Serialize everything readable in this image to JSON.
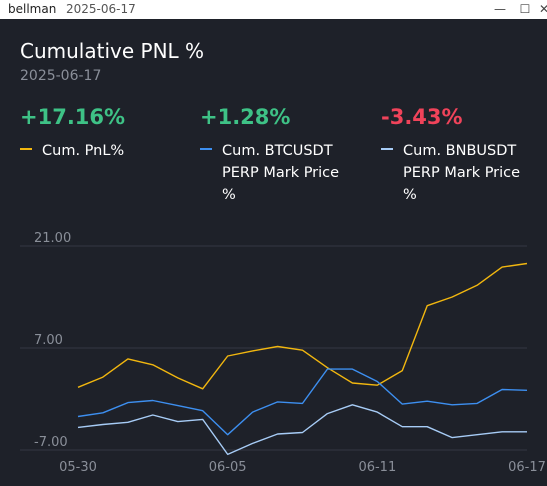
{
  "window": {
    "app_name": "bellman",
    "title_date": "2025-06-17",
    "min_glyph": "—",
    "max_glyph": "☐",
    "close_glyph": "✕"
  },
  "panel": {
    "title": "Cumulative PNL %",
    "subtitle": "2025-06-17"
  },
  "stats": [
    {
      "value": "+17.16%",
      "color": "#3ec286",
      "legend_lines": [
        "Cum. PnL%"
      ],
      "legend_color": "#f2b70f"
    },
    {
      "value": "+1.28%",
      "color": "#3ec286",
      "legend_lines": [
        "Cum. BTCUSDT",
        "PERP Mark Price",
        "%"
      ],
      "legend_color": "#3d8ff0"
    },
    {
      "value": "-3.43%",
      "color": "#f0435a",
      "legend_lines": [
        "Cum. BNBUSDT",
        "PERP Mark Price",
        "%"
      ],
      "legend_color": "#a7ccf6"
    }
  ],
  "chart_data": {
    "type": "line",
    "x": [
      "05-30",
      "05-31",
      "06-01",
      "06-02",
      "06-03",
      "06-04",
      "06-05",
      "06-06",
      "06-07",
      "06-08",
      "06-09",
      "06-10",
      "06-11",
      "06-12",
      "06-13",
      "06-14",
      "06-15",
      "06-16",
      "06-17"
    ],
    "x_tick_labels": [
      "05-30",
      "06-05",
      "06-11",
      "06-17"
    ],
    "y_tick_labels": [
      "21.00",
      "7.00",
      "-7.00"
    ],
    "ylim": [
      -7,
      21
    ],
    "grid": true,
    "series": [
      {
        "name": "Cum. PnL%",
        "color": "#f2b70f",
        "values": [
          1.6,
          3.0,
          5.5,
          4.7,
          2.9,
          1.4,
          5.9,
          6.6,
          7.2,
          6.7,
          4.3,
          2.2,
          1.9,
          3.9,
          12.8,
          14.0,
          15.6,
          18.1,
          18.6
        ]
      },
      {
        "name": "Cum. BTCUSDT PERP Mark Price %",
        "color": "#3d8ff0",
        "values": [
          -2.4,
          -1.9,
          -0.5,
          -0.2,
          -0.9,
          -1.6,
          -4.9,
          -1.8,
          -0.4,
          -0.6,
          4.1,
          4.1,
          2.4,
          -0.7,
          -0.3,
          -0.8,
          -0.6,
          1.3,
          1.2
        ]
      },
      {
        "name": "Cum. BNBUSDT PERP Mark Price %",
        "color": "#a7ccf6",
        "values": [
          -3.9,
          -3.5,
          -3.2,
          -2.2,
          -3.1,
          -2.8,
          -7.6,
          -6.1,
          -4.8,
          -4.6,
          -2.0,
          -0.8,
          -1.8,
          -3.8,
          -3.8,
          -5.3,
          -4.9,
          -4.5,
          -4.5
        ]
      }
    ]
  }
}
